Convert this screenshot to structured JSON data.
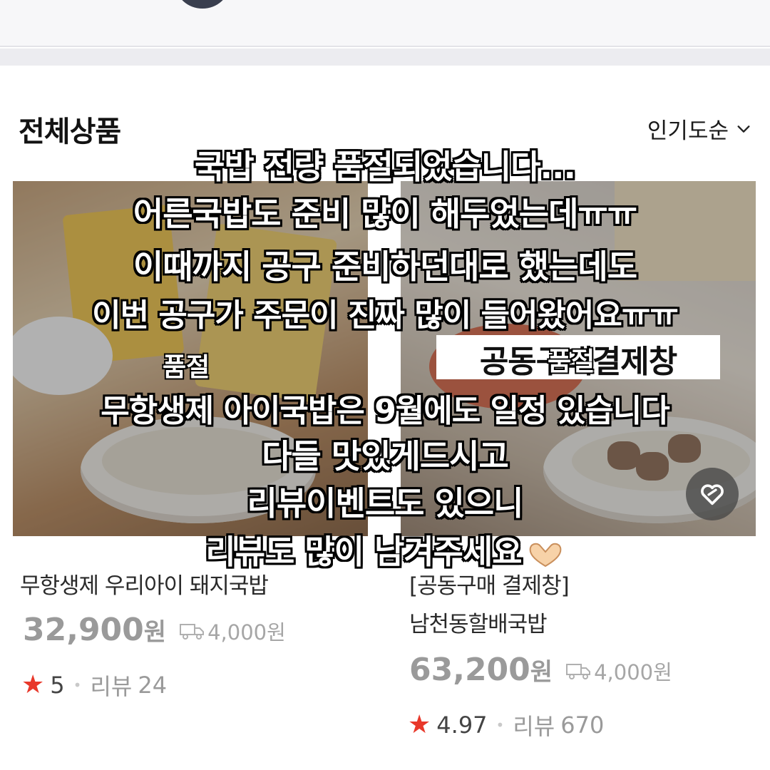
{
  "header": {
    "section_title": "전체상품",
    "sort_label": "인기도순"
  },
  "products": [
    {
      "name_line1": "무항생제 우리아이 돼지국밥",
      "price": "32,900",
      "currency": "원",
      "shipping": "4,000원",
      "rating": "5",
      "review_label": "리뷰",
      "review_count": "24",
      "badge": "품절"
    },
    {
      "name_line1": "[공동구매 결제창]",
      "name_line2": "남천동할배국밥",
      "price": "63,200",
      "currency": "원",
      "shipping": "4,000원",
      "rating": "4.97",
      "review_label": "리뷰",
      "review_count": "670",
      "badge": "품절",
      "banner": "공동구매결제창"
    }
  ],
  "overlay_lines": [
    "국밥 전량 품절되었습니다...",
    "어른국밥도 준비 많이 해두었는데ㅠㅠ",
    "이때까지 공구 준비하던대로 했는데도",
    "이번 공구가 주문이 진짜 많이 들어왔어요ㅠㅠ",
    "무항생제 아이국밥은 9월에도 일정 있습니다",
    "다들 맛있게드시고",
    "리뷰이벤트도 있으니",
    "리뷰도 많이 남겨주세요"
  ],
  "colors": {
    "star": "#e8382a",
    "price_gray": "#9a9a9a",
    "topbar": "#f7f7f9"
  },
  "icons": {
    "sort": "chevron-down-icon",
    "favorite": "heart-outline-icon",
    "shipping": "truck-icon",
    "rating": "star-icon"
  }
}
